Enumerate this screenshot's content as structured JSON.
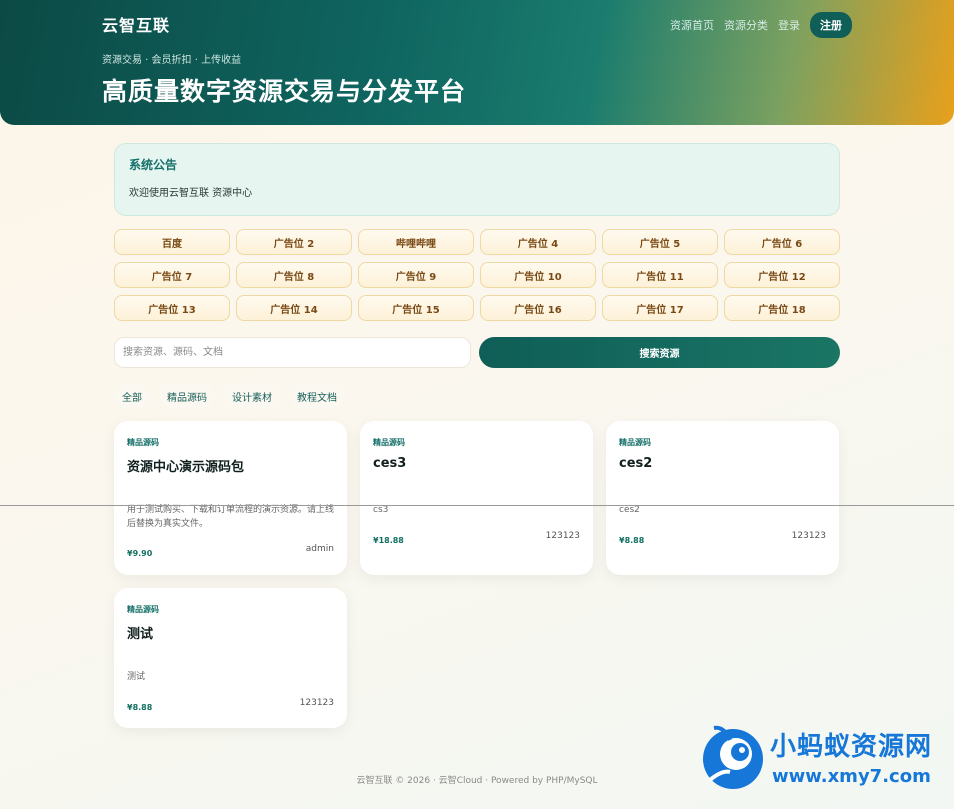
{
  "header": {
    "brand": "云智互联",
    "nav": [
      "资源首页",
      "资源分类",
      "登录"
    ],
    "register": "注册",
    "tagline": "资源交易 · 会员折扣 · 上传收益",
    "title": "高质量数字资源交易与分发平台"
  },
  "notice": {
    "title": "系统公告",
    "text": "欢迎使用云智互联 资源中心"
  },
  "ads": [
    "百度",
    "广告位 2",
    "哔哩哔哩",
    "广告位 4",
    "广告位 5",
    "广告位 6",
    "广告位 7",
    "广告位 8",
    "广告位 9",
    "广告位 10",
    "广告位 11",
    "广告位 12",
    "广告位 13",
    "广告位 14",
    "广告位 15",
    "广告位 16",
    "广告位 17",
    "广告位 18"
  ],
  "search": {
    "placeholder": "搜索资源、源码、文档",
    "button": "搜索资源"
  },
  "filters": [
    "全部",
    "精品源码",
    "设计素材",
    "教程文档"
  ],
  "cards": [
    {
      "category": "精品源码",
      "title": "资源中心演示源码包",
      "desc": "用于测试购买、下载和订单流程的演示资源。请上线后替换为真实文件。",
      "price": "¥9.90",
      "author": "admin"
    },
    {
      "category": "精品源码",
      "title": "ces3",
      "desc": "cs3",
      "price": "¥18.88",
      "author": "123123"
    },
    {
      "category": "精品源码",
      "title": "ces2",
      "desc": "ces2",
      "price": "¥8.88",
      "author": "123123"
    },
    {
      "category": "精品源码",
      "title": "测试",
      "desc": "测试",
      "price": "¥8.88",
      "author": "123123"
    }
  ],
  "footer": "云智互联 © 2026 · 云智Cloud · Powered by PHP/MySQL",
  "watermark": {
    "title": "小蚂蚁资源网",
    "url": "www.xmy7.com"
  },
  "colors": {
    "primary": "#0f5e57",
    "accent": "#e8a01b",
    "watermark": "#1677d8"
  }
}
